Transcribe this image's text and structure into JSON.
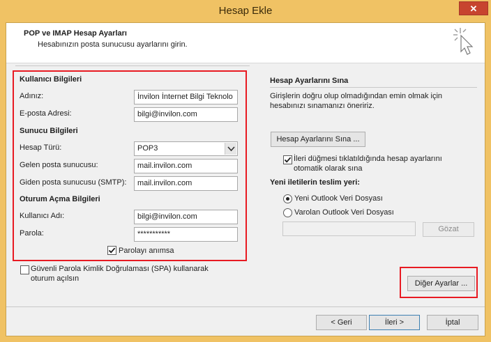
{
  "window": {
    "title": "Hesap Ekle",
    "close_glyph": "✕"
  },
  "header": {
    "title": "POP ve IMAP Hesap Ayarları",
    "subtitle": "Hesabınızın posta sunucusu ayarlarını girin.",
    "icon": "wizard-cursor-icon"
  },
  "user_info": {
    "group_label": "Kullanıcı Bilgileri",
    "name_label": "Adınız:",
    "name_value": "İnvilon İnternet Bilgi Teknolo",
    "email_label": "E-posta Adresi:",
    "email_value": "bilgi@invilon.com"
  },
  "server_info": {
    "group_label": "Sunucu Bilgileri",
    "account_type_label": "Hesap Türü:",
    "account_type_value": "POP3",
    "incoming_label": "Gelen posta sunucusu:",
    "incoming_value": "mail.invilon.com",
    "outgoing_label": "Giden posta sunucusu (SMTP):",
    "outgoing_value": "mail.invilon.com"
  },
  "login_info": {
    "group_label": "Oturum Açma Bilgileri",
    "username_label": "Kullanıcı Adı:",
    "username_value": "bilgi@invilon.com",
    "password_label": "Parola:",
    "password_value": "***********",
    "remember_label": "Parolayı anımsa",
    "remember_checked": true
  },
  "spa": {
    "label_line1": "Güvenli Parola Kimlik Doğrulaması (SPA) kullanarak",
    "label_line2": "oturum açılsın",
    "checked": false
  },
  "test": {
    "title": "Hesap Ayarlarını Sına",
    "desc_line1": "Girişlerin doğru olup olmadığından emin olmak için",
    "desc_line2": "hesabınızı sınamanızı öneririz.",
    "button_label": "Hesap Ayarlarını Sına ...",
    "auto_line1": "İleri düğmesi tıklatıldığında hesap ayarlarını",
    "auto_line2": "otomatik olarak sına",
    "auto_checked": true
  },
  "delivery": {
    "title": "Yeni iletilerin teslim yeri:",
    "option_new": "Yeni Outlook Veri Dosyası",
    "option_existing": "Varolan Outlook Veri Dosyası",
    "selected": "new",
    "path_value": "",
    "browse_label": "Gözat"
  },
  "more_settings_label": "Diğer Ayarlar ...",
  "footer": {
    "back_label": "< Geri",
    "next_label": "İleri >",
    "cancel_label": "İptal"
  },
  "colors": {
    "highlight": "#e81a22",
    "title_bar": "#f0c264",
    "close_button": "#c7442f"
  }
}
